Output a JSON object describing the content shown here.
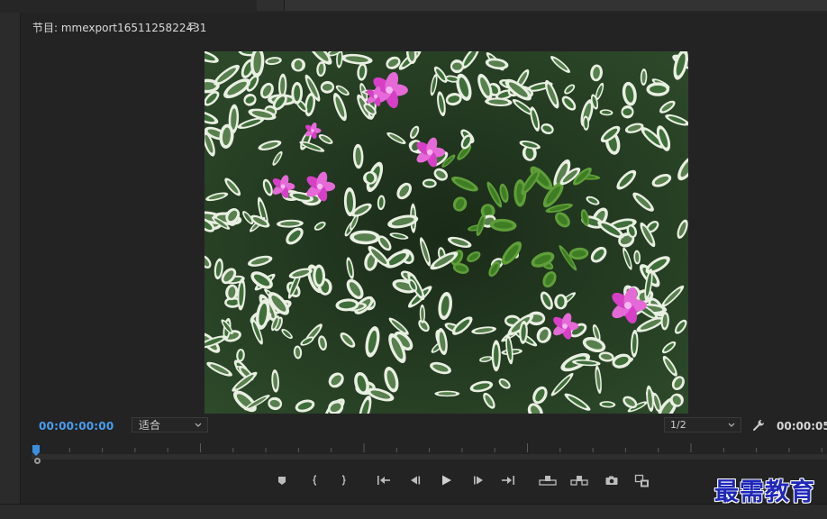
{
  "panel": {
    "title_prefix": "节目: ",
    "title_name": "mmexport1651125822431",
    "menu_icon": "hamburger-icon"
  },
  "viewer": {
    "image_subject": "flowers-and-leaves",
    "colors": {
      "accent": "#4a9ef0",
      "flower": "#d63fc6",
      "leaf_dark": "#2f5a2c",
      "leaf_light": "#e8f0df"
    }
  },
  "controls": {
    "timecode_current": "00:00:00:00",
    "fit_value": "适合",
    "resolution_value": "1/2",
    "timecode_duration": "00:00:05"
  },
  "transport": {
    "buttons": [
      {
        "name": "add-marker-button",
        "icon": "marker-icon"
      },
      {
        "name": "mark-in-button",
        "icon": "mark-in-icon"
      },
      {
        "name": "mark-out-button",
        "icon": "mark-out-icon"
      },
      {
        "name": "go-to-in-button",
        "icon": "go-to-in-icon"
      },
      {
        "name": "step-back-button",
        "icon": "step-back-icon"
      },
      {
        "name": "play-button",
        "icon": "play-icon"
      },
      {
        "name": "step-forward-button",
        "icon": "step-forward-icon"
      },
      {
        "name": "go-to-out-button",
        "icon": "go-to-out-icon"
      },
      {
        "name": "lift-button",
        "icon": "lift-icon"
      },
      {
        "name": "extract-button",
        "icon": "extract-icon"
      },
      {
        "name": "export-frame-button",
        "icon": "camera-icon"
      },
      {
        "name": "comparison-view-button",
        "icon": "comparison-icon"
      }
    ]
  },
  "watermark": {
    "text": "最需教育",
    "color": "#1f27b8"
  }
}
